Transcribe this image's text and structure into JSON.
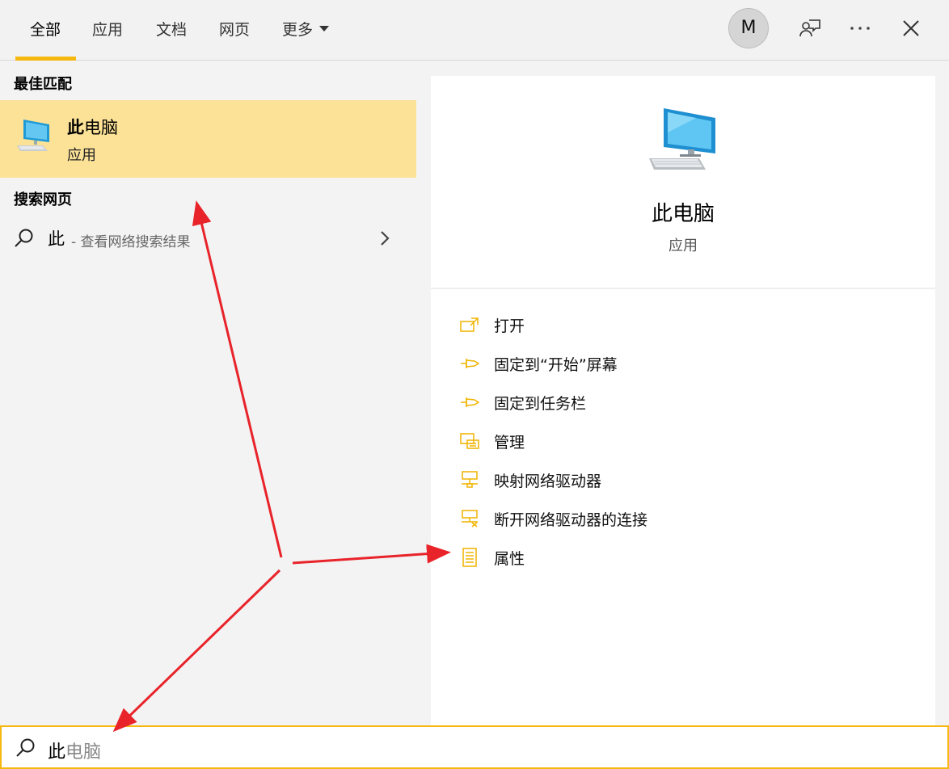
{
  "tabs": [
    {
      "label": "全部",
      "active": true
    },
    {
      "label": "应用",
      "active": false
    },
    {
      "label": "文档",
      "active": false
    },
    {
      "label": "网页",
      "active": false
    },
    {
      "label": "更多",
      "active": false
    }
  ],
  "avatar_letter": "M",
  "accent_color": "#f6b80f",
  "highlight_color": "#fce297",
  "annotation_color": "#e8232a",
  "best_match": {
    "heading": "最佳匹配",
    "title_bold": "此",
    "title_rest": "电脑",
    "subtitle": "应用",
    "icon": "computer-icon"
  },
  "web_search": {
    "heading": "搜索网页",
    "query": "此",
    "description": "- 查看网络搜索结果"
  },
  "preview": {
    "title": "此电脑",
    "subtitle": "应用",
    "icon": "computer-icon"
  },
  "actions": [
    {
      "label": "打开",
      "icon": "open-icon"
    },
    {
      "label": "固定到“开始”屏幕",
      "icon": "pin-icon"
    },
    {
      "label": "固定到任务栏",
      "icon": "pin-icon"
    },
    {
      "label": "管理",
      "icon": "manage-icon"
    },
    {
      "label": "映射网络驱动器",
      "icon": "map-network-drive-icon"
    },
    {
      "label": "断开网络驱动器的连接",
      "icon": "disconnect-network-drive-icon"
    },
    {
      "label": "属性",
      "icon": "properties-icon"
    }
  ],
  "search": {
    "typed": "此",
    "suggestion": "电脑"
  }
}
